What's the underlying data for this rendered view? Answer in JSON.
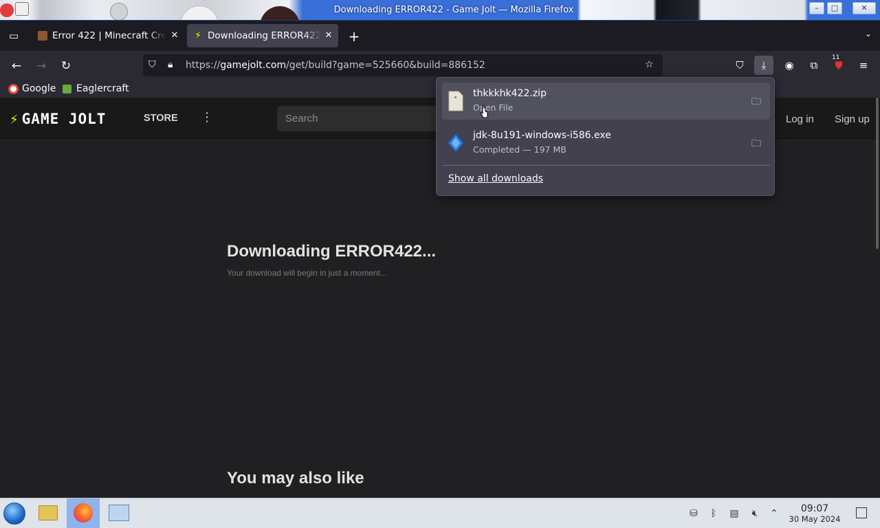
{
  "window": {
    "title": "Downloading ERROR422 - Game Jolt — Mozilla Firefox",
    "minimize_glyph": "–",
    "maximize_glyph": "□",
    "close_glyph": "✕"
  },
  "tabs": [
    {
      "label": "Error 422 | Minecraft Cre",
      "favicon": "minecraft-favicon-icon",
      "close_glyph": "✕"
    },
    {
      "label": "Downloading ERROR422",
      "favicon": "gamejolt-favicon-icon",
      "close_glyph": "✕",
      "active": true
    }
  ],
  "toolbar": {
    "new_tab_glyph": "+",
    "list_all_glyph": "⌄",
    "url_prefix": "https://",
    "url_domain": "gamejolt.com",
    "url_path": "/get/build?game=525660&build=886152",
    "extensions_badge": "11"
  },
  "bookmarks": [
    {
      "label": "Google",
      "icon": "google-icon",
      "color": "#ea4335"
    },
    {
      "label": "Eaglercraft",
      "icon": "eaglercraft-icon",
      "color": "#6aaa3a"
    }
  ],
  "site": {
    "logo_text": "GAME JOLT",
    "store_label": "STORE",
    "more_glyph": "⋮",
    "search_placeholder": "Search",
    "login_label": "Log in",
    "signup_label": "Sign up",
    "heading": "Downloading ERROR422...",
    "subheading": "Your download will begin in just a moment...",
    "also_like": "You may also like"
  },
  "downloads_panel": {
    "items": [
      {
        "filename": "thkkkhk422.zip",
        "status": "Open File",
        "icon": "zip-file-icon"
      },
      {
        "filename": "jdk-8u191-windows-i586.exe",
        "status": "Completed — 197 MB",
        "icon": "exe-file-icon"
      }
    ],
    "show_all_label": "Show all downloads"
  },
  "taskbar": {
    "time": "09:07",
    "date": "30 May 2024",
    "apps": [
      "file-manager-icon",
      "firefox-icon",
      "control-panel-icon"
    ]
  },
  "colors": {
    "gamejolt_accent": "#ccff00",
    "panel_bg": "#42414d",
    "page_bg": "#202023"
  }
}
